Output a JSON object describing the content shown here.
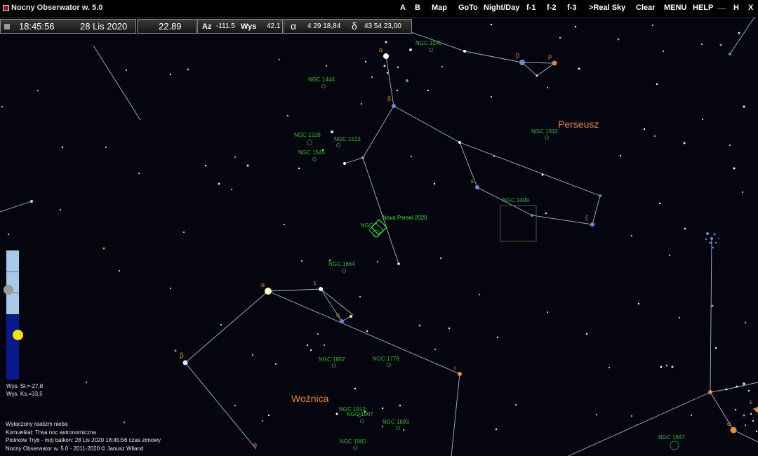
{
  "window": {
    "title": "Nocny Obserwator w. 5.0"
  },
  "menu": {
    "a": "A",
    "b": "B",
    "map": "Map",
    "goto": "GoTo",
    "night_day": "Night/Day",
    "f1": "f-1",
    "f2": "f-2",
    "f3": "f-3",
    "real_sky": ">Real Sky",
    "clear": "Clear",
    "menu": "MENU",
    "help": "HELP",
    "minimize": "__",
    "h": "H",
    "close": "X"
  },
  "info": {
    "time": "18:45:56",
    "date": "28 Lis 2020",
    "sidereal": "22.89",
    "az_label": "Az",
    "az_value": "-111.5",
    "alt_label": "Wys",
    "alt_value": "42.1",
    "ra_label": "α",
    "ra_value": "4 29 18,84",
    "dec_label": "δ",
    "dec_value": "43 54 23,00"
  },
  "constellations": {
    "perseus": "Perseusz",
    "auriga": "Woźnica"
  },
  "objects": {
    "ngc1245": "NGC 1245",
    "ngc1444": "NGC 1444",
    "ngc1528": "NGC 1528",
    "ngc1513": "NGC 1513",
    "ngc1545": "NGC 1545",
    "ngc1342": "NGC 1342",
    "ngc1499": "NGC 1499",
    "ngc1582": "NGC",
    "nova": "Nova Persei 2020",
    "ngc1664": "NGC 1664",
    "ngc1857": "NGC 1857",
    "ngc1778": "NGC 1778",
    "ngc1912": "NGC 1912",
    "ngc1907": "NGC 1907",
    "ngc1893": "NGC 1893",
    "ngc1960": "NGC 1960",
    "ngc1647": "NGC 1647"
  },
  "greek": {
    "per_alpha": "α",
    "per_delta": "δ",
    "per_beta": "β",
    "per_rho": "ρ",
    "per_epsilon": "ε",
    "per_zeta": "ζ",
    "aur_alpha": "α",
    "aur_epsilon": "ε",
    "aur_eta": "η",
    "aur_beta": "β",
    "aur_iota": "ι",
    "aur_theta": "θ",
    "tau_alpha": "α",
    "tau_epsilon": "ε"
  },
  "altitude": {
    "sun": "Wys. Sł.=-27,8",
    "moon": "Wys. Ks.=33,5"
  },
  "status": {
    "realism": "Wyłączony realizm nieba",
    "message": "Komunikat: Trwa noc astronomiczna",
    "location": "Piotrków Tryb - mój balkon:  28 Lis 2020   18:45:56  czas zimowy",
    "copyright": "Nocny Obserwator w. 5.0 - 2011-2020 © Janusz Wiland"
  },
  "colors": {
    "sky": "#05050f",
    "constellation_line": "#a8b4c8",
    "ngc_label": "#35b83a",
    "constellation_name": "#e8823a",
    "sun_marker": "#f2e200",
    "altitude_day": "#a8c8e8",
    "altitude_night": "#0a1a8c"
  }
}
